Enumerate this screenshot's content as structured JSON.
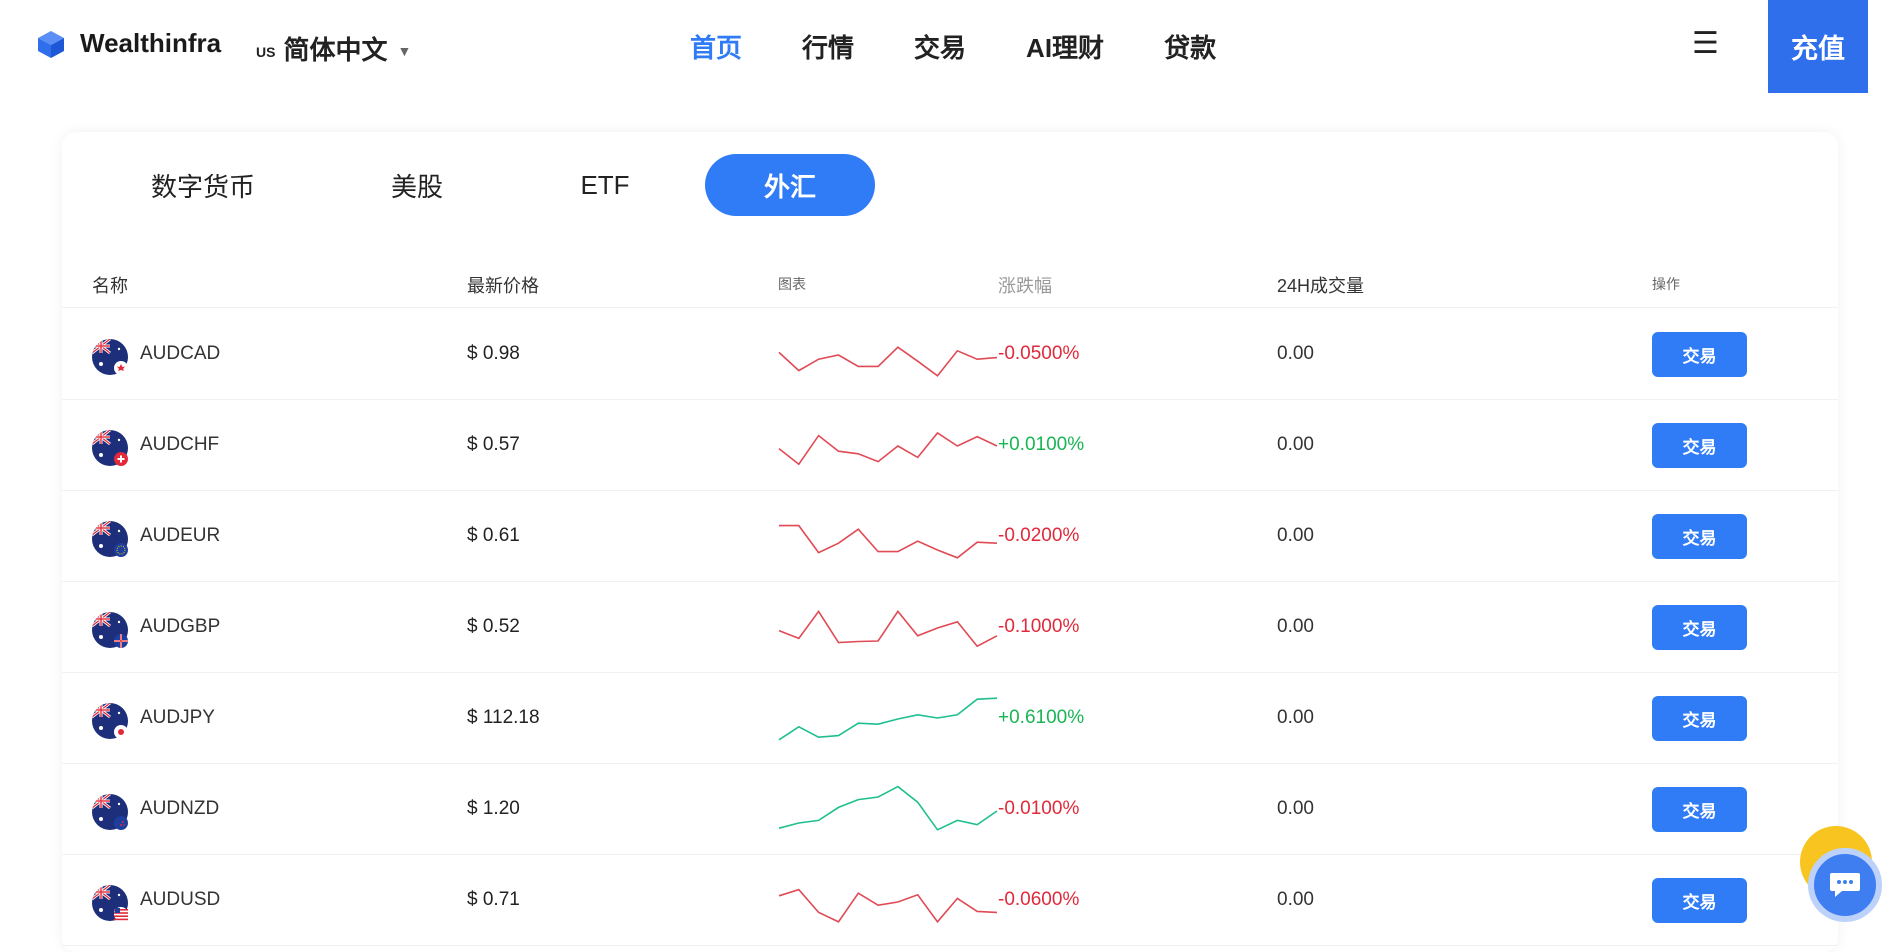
{
  "brand": {
    "name": "Wealthinfra",
    "accent": "#2f7cf6"
  },
  "language": {
    "code": "US",
    "name": "简体中文",
    "caret": "▼"
  },
  "nav": [
    {
      "label": "首页",
      "active": true
    },
    {
      "label": "行情",
      "active": false
    },
    {
      "label": "交易",
      "active": false
    },
    {
      "label": "AI理财",
      "active": false
    },
    {
      "label": "贷款",
      "active": false
    }
  ],
  "header": {
    "menu_icon": "☰",
    "recharge_label": "充值"
  },
  "tabs": [
    {
      "label": "数字货币",
      "active": false
    },
    {
      "label": "美股",
      "active": false
    },
    {
      "label": "ETF",
      "active": false
    },
    {
      "label": "外汇",
      "active": true
    }
  ],
  "table": {
    "columns": {
      "name": "名称",
      "price": "最新价格",
      "chart": "图表",
      "change": "涨跌幅",
      "volume": "24H成交量",
      "action": "操作"
    },
    "trade_label": "交易",
    "rows": [
      {
        "symbol": "AUDCAD",
        "price": "$ 0.98",
        "change": "-0.0500%",
        "direction": "down",
        "volume": "0.00",
        "quote_flag": "ca",
        "spark": [
          0.55,
          0.2,
          0.42,
          0.5,
          0.28,
          0.28,
          0.65,
          0.38,
          0.1,
          0.58,
          0.42,
          0.45
        ],
        "spark_color": "#e04a55"
      },
      {
        "symbol": "AUDCHF",
        "price": "$ 0.57",
        "change": "+0.0100%",
        "direction": "up",
        "volume": "0.00",
        "quote_flag": "ch",
        "spark": [
          0.45,
          0.15,
          0.7,
          0.4,
          0.35,
          0.2,
          0.5,
          0.28,
          0.75,
          0.5,
          0.68,
          0.5
        ],
        "spark_color": "#e04a55"
      },
      {
        "symbol": "AUDEUR",
        "price": "$ 0.61",
        "change": "-0.0200%",
        "direction": "down",
        "volume": "0.00",
        "quote_flag": "eu",
        "spark": [
          0.72,
          0.72,
          0.2,
          0.38,
          0.65,
          0.22,
          0.22,
          0.42,
          0.25,
          0.1,
          0.4,
          0.38
        ],
        "spark_color": "#e04a55"
      },
      {
        "symbol": "AUDGBP",
        "price": "$ 0.52",
        "change": "-0.1000%",
        "direction": "down",
        "volume": "0.00",
        "quote_flag": "gb",
        "spark": [
          0.45,
          0.3,
          0.82,
          0.22,
          0.24,
          0.25,
          0.82,
          0.35,
          0.5,
          0.62,
          0.15,
          0.35
        ],
        "spark_color": "#e04a55"
      },
      {
        "symbol": "AUDJPY",
        "price": "$ 112.18",
        "change": "+0.6100%",
        "direction": "up",
        "volume": "0.00",
        "quote_flag": "jp",
        "spark": [
          0.1,
          0.35,
          0.15,
          0.18,
          0.42,
          0.4,
          0.5,
          0.58,
          0.52,
          0.58,
          0.88,
          0.9
        ],
        "spark_color": "#1fbf8f"
      },
      {
        "symbol": "AUDNZD",
        "price": "$ 1.20",
        "change": "-0.0100%",
        "direction": "down",
        "volume": "0.00",
        "quote_flag": "nz",
        "spark": [
          0.15,
          0.25,
          0.3,
          0.55,
          0.7,
          0.75,
          0.95,
          0.65,
          0.12,
          0.3,
          0.22,
          0.48
        ],
        "spark_color": "#1fbf8f"
      },
      {
        "symbol": "AUDUSD",
        "price": "$ 0.71",
        "change": "-0.0600%",
        "direction": "down",
        "volume": "0.00",
        "quote_flag": "us",
        "spark": [
          0.6,
          0.72,
          0.28,
          0.1,
          0.65,
          0.42,
          0.48,
          0.62,
          0.1,
          0.55,
          0.3,
          0.28
        ],
        "spark_color": "#e04a55"
      }
    ]
  }
}
